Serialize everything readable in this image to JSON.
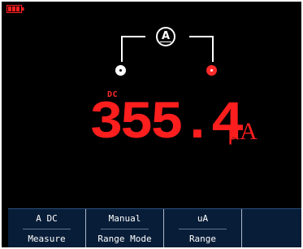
{
  "status_bar": {
    "battery_icon": "battery-low-icon",
    "battery_color": "#ff2020"
  },
  "probe_diagram": {
    "amp_symbol": "A",
    "com_terminal_color": "#ffffff",
    "amp_terminal_color": "#ff2a2a"
  },
  "display": {
    "mode": "DC",
    "value": "355.4",
    "unit": "μA",
    "value_color": "#ff1e1e"
  },
  "softkeys": [
    {
      "value": "A DC",
      "label": "Measure"
    },
    {
      "value": "Manual",
      "label": "Range Mode"
    },
    {
      "value": "uA",
      "label": "Range"
    }
  ],
  "colors": {
    "background": "#000000",
    "softkey_bar": "#081d38",
    "text": "#ffffff"
  }
}
